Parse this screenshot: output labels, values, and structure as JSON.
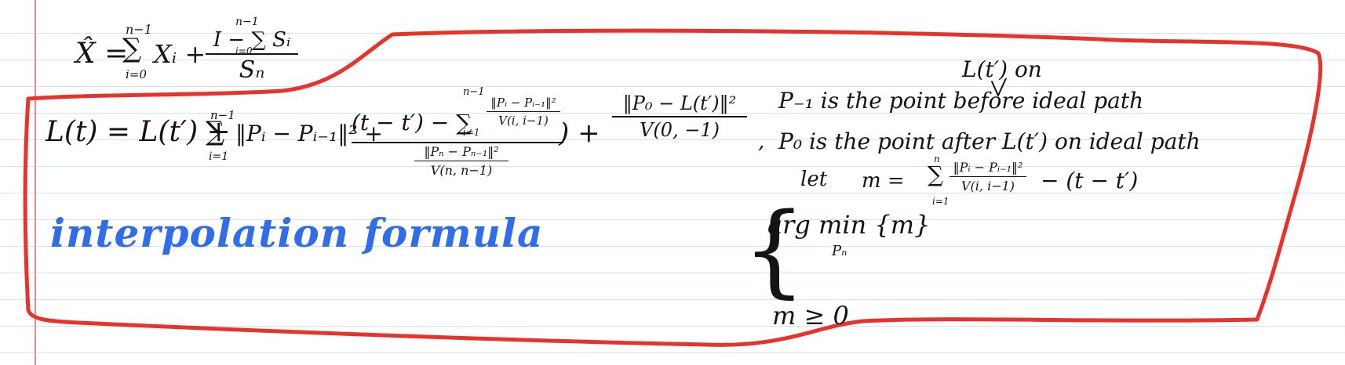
{
  "note": {
    "equations": {
      "x_hat": {
        "lhs": "X̂ =",
        "sum_top": "n−1",
        "sum_sym": "∑",
        "sum_bottom": "i=0",
        "term": "Xᵢ +",
        "frac_num": "I − ∑ Sᵢ",
        "frac_num_top": "n−1",
        "frac_num_bottom": "i=0",
        "frac_den": "Sₙ"
      },
      "l_of_t": {
        "lhs": "L(t) = L(t′) +",
        "sum_top": "n−1",
        "sum_sym": "∑",
        "sum_bottom": "i=1",
        "norm_term": "‖Pᵢ − Pᵢ₋₁‖²  +",
        "big_frac_num": "(t − t′) − ∑",
        "big_frac_num_top": "n−1",
        "big_frac_num_bottom": "i=1",
        "inner_num": "‖Pᵢ − Pᵢ₋₁‖²",
        "inner_den": "V(i, i−1)",
        "big_frac_den_num": "‖Pₙ − Pₙ₋₁‖²",
        "big_frac_den_den": "V(n, n−1)",
        "plus": ") +",
        "last_num": "‖P₀ − L(t′)‖²",
        "last_den": "V(0, −1)",
        "comma": ","
      },
      "let_m": {
        "let": "let",
        "m_eq": "m =",
        "sum_top": "n",
        "sum_sym": "∑",
        "sum_bottom": "i=1",
        "num": "‖Pᵢ − Pᵢ₋₁‖²",
        "den": "V(i, i−1)",
        "tail": "− (t − t′)"
      },
      "arg_min": {
        "brace": "{",
        "line1": "arg min {m}",
        "subscript": "Pₙ",
        "line2": "m ≥ 0"
      }
    },
    "annotations": {
      "above": "L(t′) on",
      "p_minus1": "P₋₁  is the point before ideal path",
      "p_0": "P₀  is the point after L(t′) on ideal path"
    },
    "label": "interpolation formula",
    "colors": {
      "ink": "#141414",
      "highlight_outline": "#e8322a",
      "label_ink": "#2f6ee8",
      "rule_lines": "#d3e3f1",
      "margin_line": "#ec8a8a"
    }
  }
}
